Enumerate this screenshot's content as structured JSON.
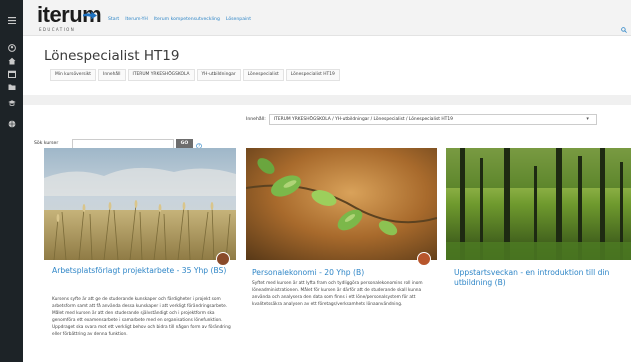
{
  "rail": {
    "icons": [
      "hamburger-icon",
      "user-circle-icon",
      "home-icon",
      "calendar-icon",
      "folder-icon",
      "graduation-cap-icon",
      "globe-icon"
    ]
  },
  "header": {
    "logo_text": "iterum",
    "logo_sub": "EDUCATION",
    "nav": [
      "Start",
      "Iterum-YH",
      "Iterum kompetensutveckling",
      "Lösenpaint"
    ]
  },
  "page": {
    "title": "Lönespecialist HT19",
    "breadcrumbs": [
      "Min kursöversikt",
      "Innehåll",
      "ITERUM YRKESHÖGSKOLA",
      "YH-utbildningar",
      "Lönespecialist",
      "Lönespecialist HT19"
    ]
  },
  "filter": {
    "label": "Innehåll:",
    "value": "ITERUM YRKESHÖGSKOLA / YH-utbildningar / Lönespecialist / Lönespecialist HT19"
  },
  "search": {
    "label": "Sök kurser",
    "value": "",
    "button": "GO"
  },
  "courses": [
    {
      "title": "Arbetsplatsförlagt projektarbete - 35 Yhp (BS)",
      "description": "Kursens syfte är att ge de studerande kunskaper och färdigheter i projekt som arbetsform samt att få använda dessa kunskaper i att verkligt förändringsarbete. Målet med kursen är att den studerande självständigt och i projektform ska genomföra ett examensarbete i samarbete med en organisations lönefunktion. Uppdraget ska svara mot ett verkligt behov och bidra till någon form av förändring eller förbättring av denna funktion."
    },
    {
      "title": "Personalekonomi - 20 Yhp (B)",
      "description": "Syftet med kursen är att lyfta fram och tydliggöra personalekonomins roll inom löneadministrationen. Målet för kursen är därför att de studerande skall kunna använda och analysera den data som finns i ett löne/personalsystem för att kvalitetssäkra analysen av ett företags/verksamhets lönaanvändning."
    },
    {
      "title": "Uppstartsveckan - en introduktion till din utbildning (B)",
      "description": ""
    }
  ]
}
